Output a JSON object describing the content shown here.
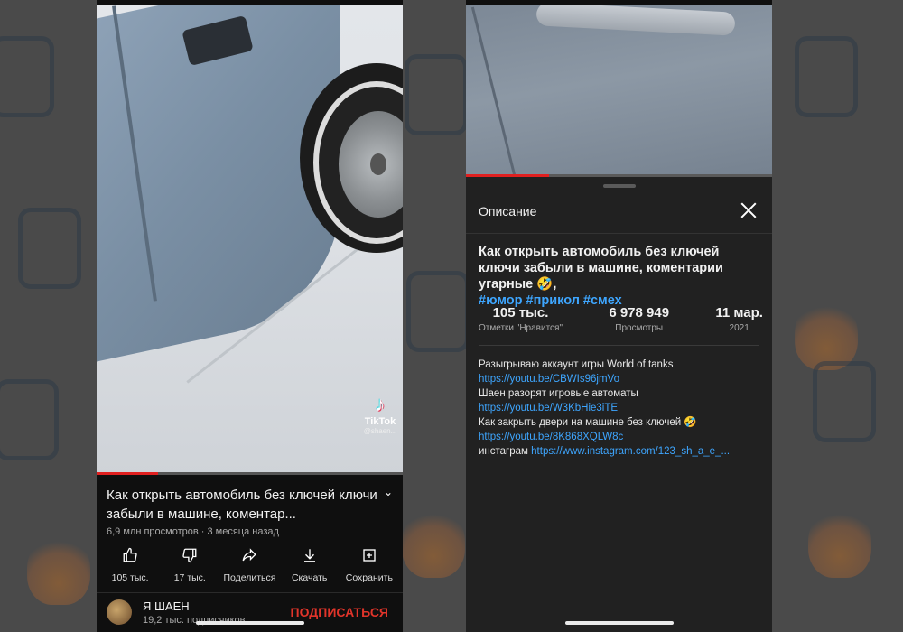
{
  "left": {
    "video": {
      "watermark_brand": "TikTok",
      "watermark_handle": "@shaen..."
    },
    "title": "Как открыть автомобиль без ключей ключи забыли в машине, коментар...",
    "meta": "6,9 млн просмотров · 3 месяца назад",
    "actions": [
      {
        "icon": "thumbs-up-icon",
        "label": "105 тыс."
      },
      {
        "icon": "thumbs-down-icon",
        "label": "17 тыс."
      },
      {
        "icon": "share-icon",
        "label": "Поделиться"
      },
      {
        "icon": "download-icon",
        "label": "Скачать"
      },
      {
        "icon": "save-icon",
        "label": "Сохранить"
      }
    ],
    "channel": {
      "name": "Я ШАЕН",
      "subscribers": "19,2 тыс. подписчиков",
      "subscribe_label": "ПОДПИСАТЬСЯ"
    },
    "progress": 0.2
  },
  "right": {
    "sheet_title": "Описание",
    "full_title": "Как открыть автомобиль без ключей ключи забыли в машине, коментарии угарные 🤣,",
    "hashtags": "#юмор #прикол #смех",
    "stats": [
      {
        "value": "105 тыс.",
        "label": "Отметки \"Нравится\""
      },
      {
        "value": "6 978 949",
        "label": "Просмотры"
      },
      {
        "value": "11 мар.",
        "label": "2021"
      }
    ],
    "description": [
      {
        "text": "Разыгрываю аккаунт игры World of tanks ",
        "link": "https://youtu.be/CBWIs96jmVo"
      },
      {
        "text": "Шаен разорят игровые автоматы ",
        "link": "https://youtu.be/W3KbHie3iTE"
      },
      {
        "text": "Как закрыть двери на машине без ключей 🤣 ",
        "link": "https://youtu.be/8K868XQLW8c"
      },
      {
        "text": "инстаграм ",
        "link": "https://www.instagram.com/123_sh_a_e_..."
      }
    ],
    "progress": 0.27
  },
  "colors": {
    "accent_red": "#e0342a",
    "link_blue": "#3ea6ff",
    "sheet_bg": "#212121",
    "app_bg": "#0f0f0f"
  }
}
